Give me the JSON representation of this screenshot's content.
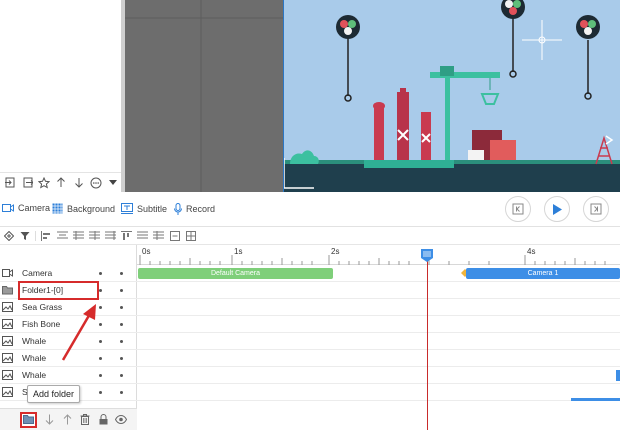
{
  "colors": {
    "accent": "#2d7fd8",
    "highlight": "#d62b2b",
    "clip_green": "#7fcf7a",
    "clip_blue": "#3d8ee6",
    "scene_sky": "#a9cbea",
    "scene_ground": "#1f3f4d"
  },
  "left_toolbar": {
    "icons": [
      "import-icon",
      "export-icon",
      "star-icon",
      "arrow-up-icon",
      "arrow-down-icon",
      "more-icon",
      "dropdown-icon"
    ]
  },
  "tools": {
    "camera": "Camera",
    "background": "Background",
    "subtitle": "Subtitle",
    "record": "Record"
  },
  "ruler": {
    "ticks": [
      "0s",
      "1s",
      "2s",
      "4s"
    ]
  },
  "tracks": [
    {
      "label": "Camera",
      "icon": "camera-icon"
    },
    {
      "label": "Folder1-[0]",
      "icon": "folder-icon"
    },
    {
      "label": "Sea Grass",
      "icon": "image-icon"
    },
    {
      "label": "Fish Bone",
      "icon": "image-icon"
    },
    {
      "label": "Whale",
      "icon": "image-icon"
    },
    {
      "label": "Whale",
      "icon": "image-icon"
    },
    {
      "label": "Whale",
      "icon": "image-icon"
    },
    {
      "label": "S",
      "icon": "image-icon"
    }
  ],
  "clips": {
    "default_camera": "Default Camera",
    "camera1": "Camera 1"
  },
  "tooltip": {
    "text": "Add folder"
  }
}
